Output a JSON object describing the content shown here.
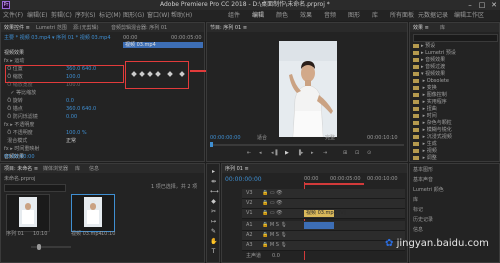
{
  "app": {
    "title": "Adobe Premiere Pro CC 2018 - D:\\桌面制作\\未命名.prproj *",
    "icon_label": "Pr"
  },
  "menu": {
    "items": [
      "文件(F)",
      "编辑(E)",
      "剪辑(C)",
      "序列(S)",
      "标记(M)",
      "图形(G)",
      "窗口(W)",
      "帮助(H)"
    ],
    "workspaces": [
      "组件",
      "编辑",
      "颜色",
      "效果",
      "音频",
      "图形",
      "库",
      "所有面板",
      "元数据记录",
      "编辑工作区"
    ]
  },
  "effect_controls": {
    "tabs": [
      "效果控件 ≡",
      "Lumetri 范围",
      "源:(无剪辑)",
      "音频剪辑混合器: 序列 01"
    ],
    "header": "主要 * 视频 03.mp4 ▾ 序列 01 * 视频 03.mp4",
    "ruler_start": "00:00",
    "ruler_end": "00:00:05:00",
    "clip_label": "视频 03.mp4",
    "sections": [
      {
        "label": "视频效果",
        "value": ""
      },
      {
        "label": "fx ▸ 运动",
        "value": ""
      },
      {
        "label": "Ö 位置",
        "value": "360.0  640.0"
      },
      {
        "label": "Ö 缩放",
        "value": "100.0"
      },
      {
        "label": "Ö 缩放宽度",
        "value": "100.0"
      },
      {
        "label": "✓ 等比缩放",
        "value": ""
      },
      {
        "label": "Ö 旋转",
        "value": "0.0"
      },
      {
        "label": "Ö 锚点",
        "value": "360.0  640.0"
      },
      {
        "label": "Ö 防闪烁滤镜",
        "value": "0.00"
      },
      {
        "label": "fx ▸ 不透明度",
        "value": ""
      },
      {
        "label": "Ö 不透明度",
        "value": "100.0 %"
      },
      {
        "label": "混合模式",
        "value": "正常"
      },
      {
        "label": "fx ▸ 时间重映射",
        "value": ""
      },
      {
        "label": "音频效果",
        "value": ""
      }
    ],
    "timecode": "00:00:00:00"
  },
  "program_monitor": {
    "tab": "节目: 序列 01 ≡",
    "timecode": "00:00:00:00",
    "fit": "适合",
    "quality": "完整",
    "duration": "00:00:10:10",
    "transport": [
      "⇤",
      "◂",
      "◂▐",
      "▶",
      "▐▸",
      "▸",
      "⇥",
      "⊞",
      "⊡",
      "⊙"
    ]
  },
  "right_panel": {
    "tabs": [
      "效果 ≡",
      "库"
    ],
    "search_placeholder": "",
    "tree": [
      "▸ 预设",
      "▸ Lumetri 预设",
      "▸ 音频效果",
      "▸ 音频过渡",
      "▾ 视频效果",
      "  ▸ Obsolete",
      "  ▸ 变换",
      "  ▸ 图像控制",
      "  ▸ 实用程序",
      "  ▸ 扭曲",
      "  ▸ 时间",
      "  ▸ 杂色与颗粒",
      "  ▸ 模糊与锐化",
      "  ▸ 沉浸式视频",
      "  ▸ 生成",
      "  ▸ 视频",
      "  ▸ 调整",
      "▸ 视频过渡"
    ],
    "bottom_tabs": [
      "基本图形",
      "基本声音",
      "Lumetri 颜色",
      "库",
      "标记",
      "历史记录",
      "信息"
    ]
  },
  "project": {
    "tabs": [
      "项目: 未命名 ≡",
      "媒体浏览器",
      "库",
      "信息"
    ],
    "file": "未命名.prproj",
    "count": "1 项已选择，共 2 项",
    "items": [
      {
        "name": "序列 01",
        "duration": "10:10"
      },
      {
        "name": "视频 03.mp4",
        "duration": "10:10"
      }
    ]
  },
  "timeline": {
    "tab": "序列 01 ≡",
    "timecode": "00:00:00:00",
    "ruler": [
      "00:00",
      "00:00:05:00",
      "00:00:10:00"
    ],
    "video_tracks": [
      "V3",
      "V2",
      "V1"
    ],
    "audio_tracks": [
      "A1",
      "A2",
      "A3"
    ],
    "clip_v1": "视频 03.mp4 [V]",
    "clip_a1": "",
    "master": "主声道",
    "master_value": "0.0"
  },
  "tools": [
    "▸",
    "⇹",
    "⟷",
    "◆",
    "✂",
    "↦",
    "✎",
    "✋",
    "T"
  ],
  "watermark": "jingyan.baidu.com",
  "colors": {
    "accent_blue": "#3f8fd2",
    "highlight_red": "#e23b3b",
    "clip_yellow": "#d9b85a",
    "clip_blue": "#3d6eb5",
    "playhead_red": "#d23a3a"
  }
}
